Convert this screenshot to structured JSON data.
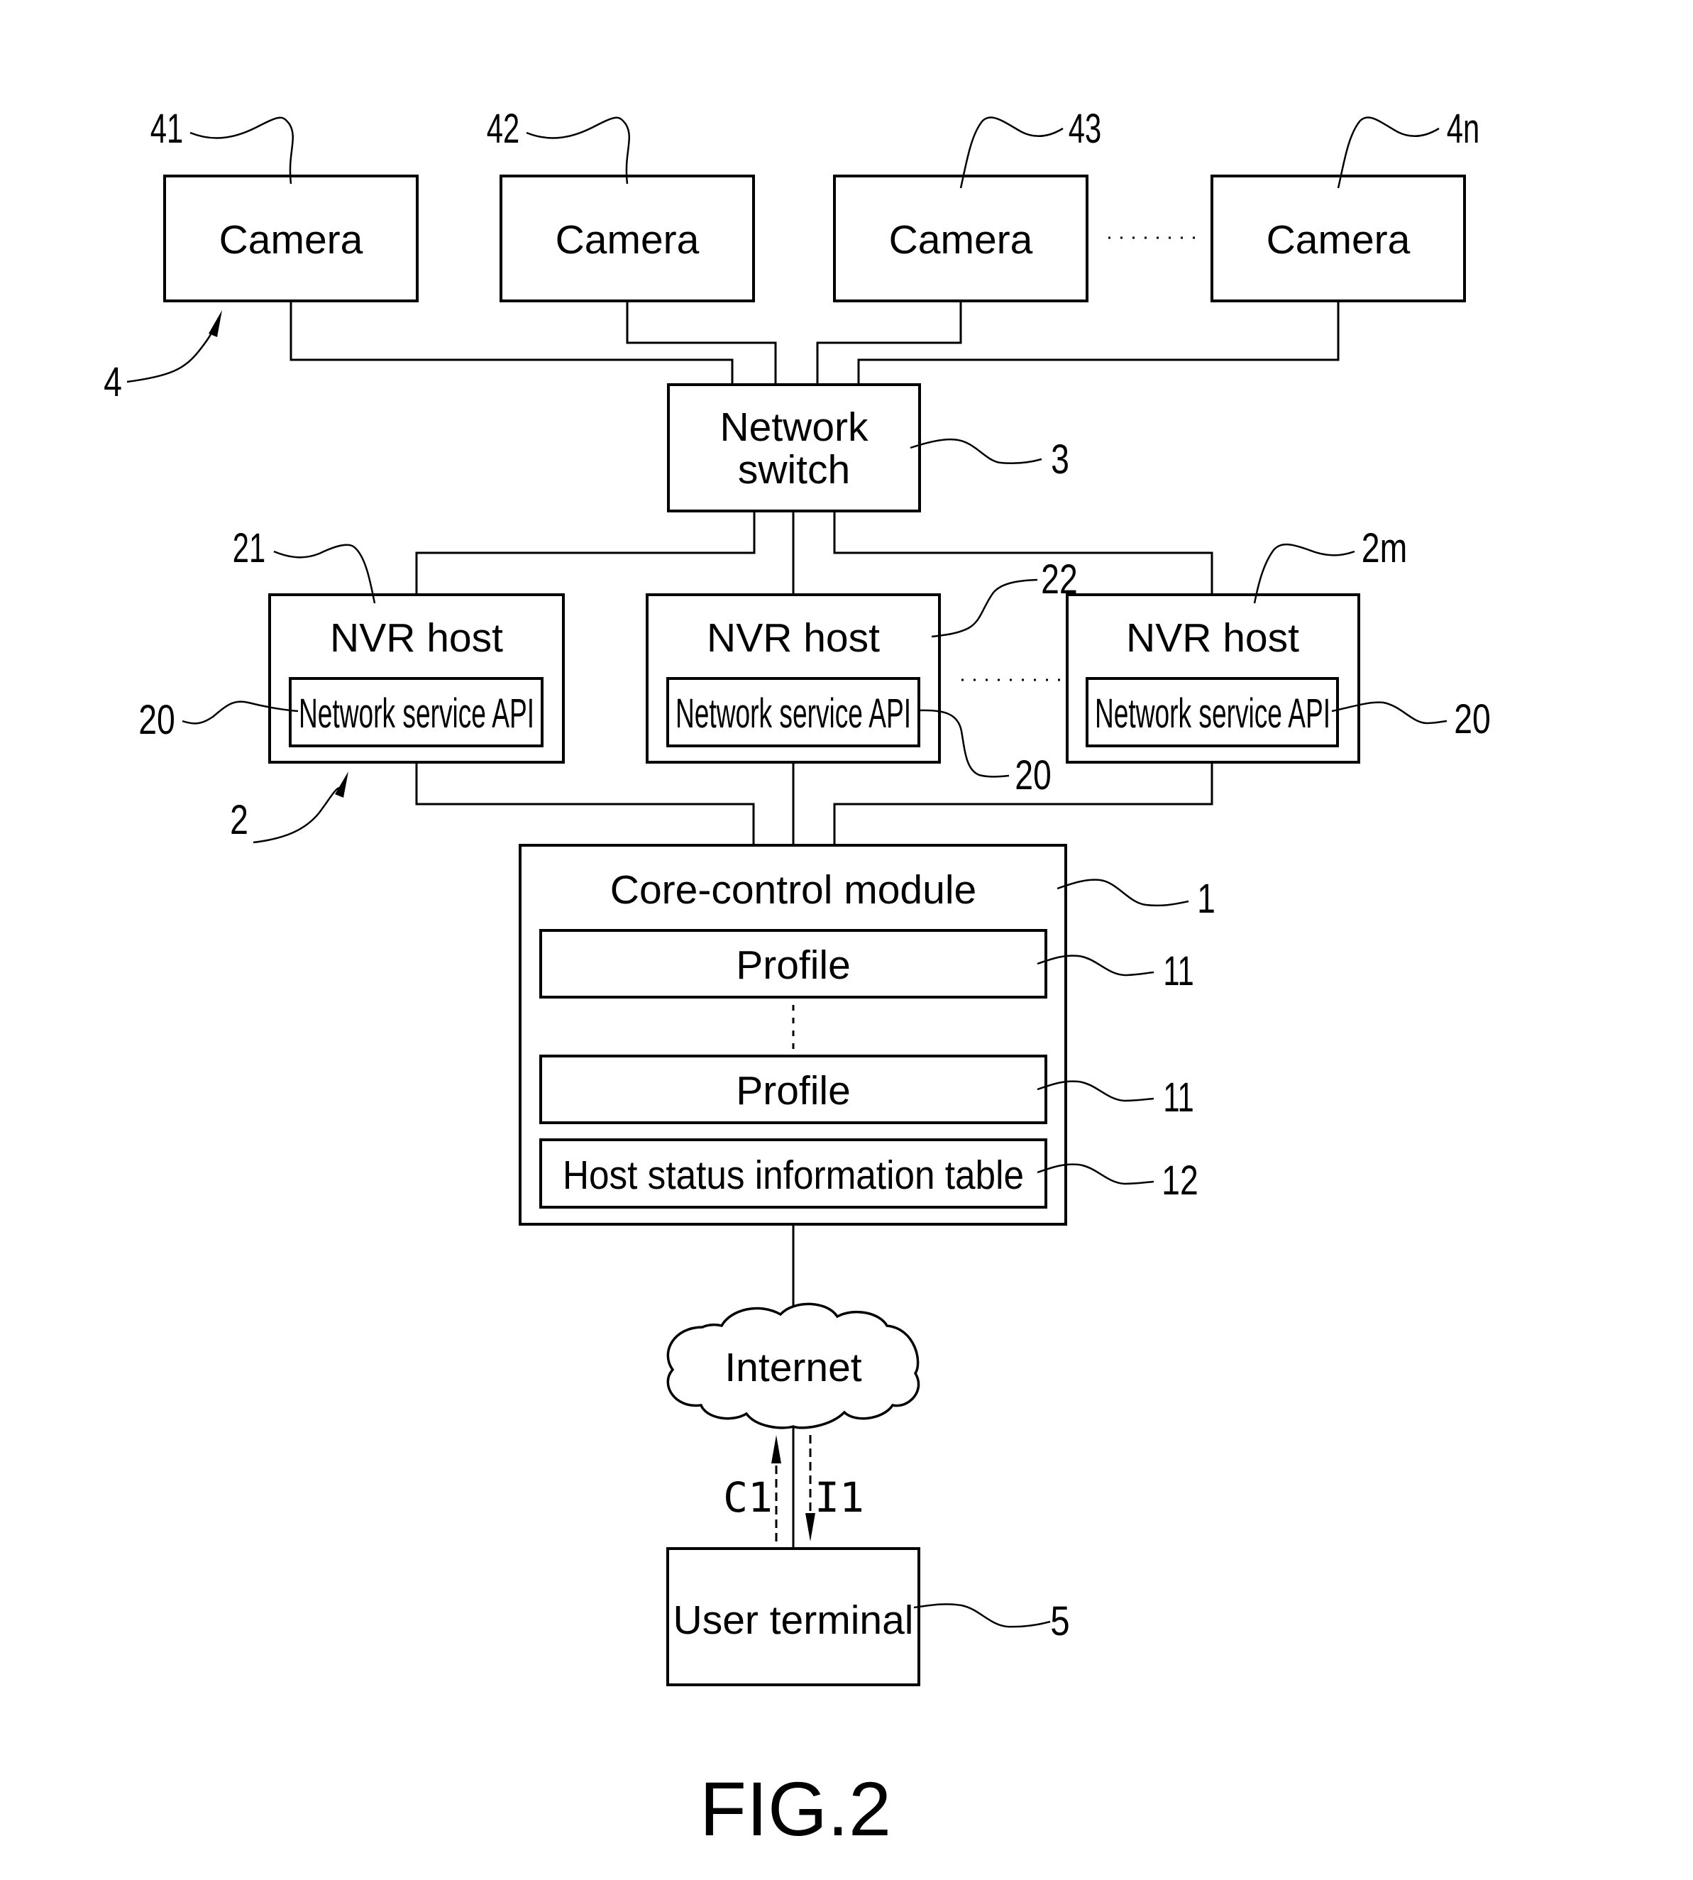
{
  "figure": {
    "caption": "FIG.2",
    "colors": {
      "line": "#000000",
      "background": "#ffffff"
    }
  },
  "cameras": {
    "group_ref": "4",
    "items": [
      {
        "label": "Camera",
        "ref": "41"
      },
      {
        "label": "Camera",
        "ref": "42"
      },
      {
        "label": "Camera",
        "ref": "43"
      },
      {
        "label": "Camera",
        "ref": "4n"
      }
    ]
  },
  "network_switch": {
    "label_line1": "Network",
    "label_line2": "switch",
    "ref": "3"
  },
  "nvr_hosts": {
    "group_ref": "2",
    "items": [
      {
        "label": "NVR host",
        "ref": "21",
        "api_label": "Network service API",
        "api_ref": "20"
      },
      {
        "label": "NVR host",
        "ref": "22",
        "api_label": "Network service API",
        "api_ref": "20"
      },
      {
        "label": "NVR host",
        "ref": "2m",
        "api_label": "Network service API",
        "api_ref": "20"
      }
    ]
  },
  "core_control": {
    "label": "Core-control module",
    "ref": "1",
    "profiles": [
      {
        "label": "Profile",
        "ref": "11"
      },
      {
        "label": "Profile",
        "ref": "11"
      }
    ],
    "host_table": {
      "label": "Host status information table",
      "ref": "12"
    }
  },
  "internet": {
    "label": "Internet"
  },
  "signals": {
    "up": "C1",
    "down": "I1"
  },
  "user_terminal": {
    "label": "User terminal",
    "ref": "5"
  }
}
